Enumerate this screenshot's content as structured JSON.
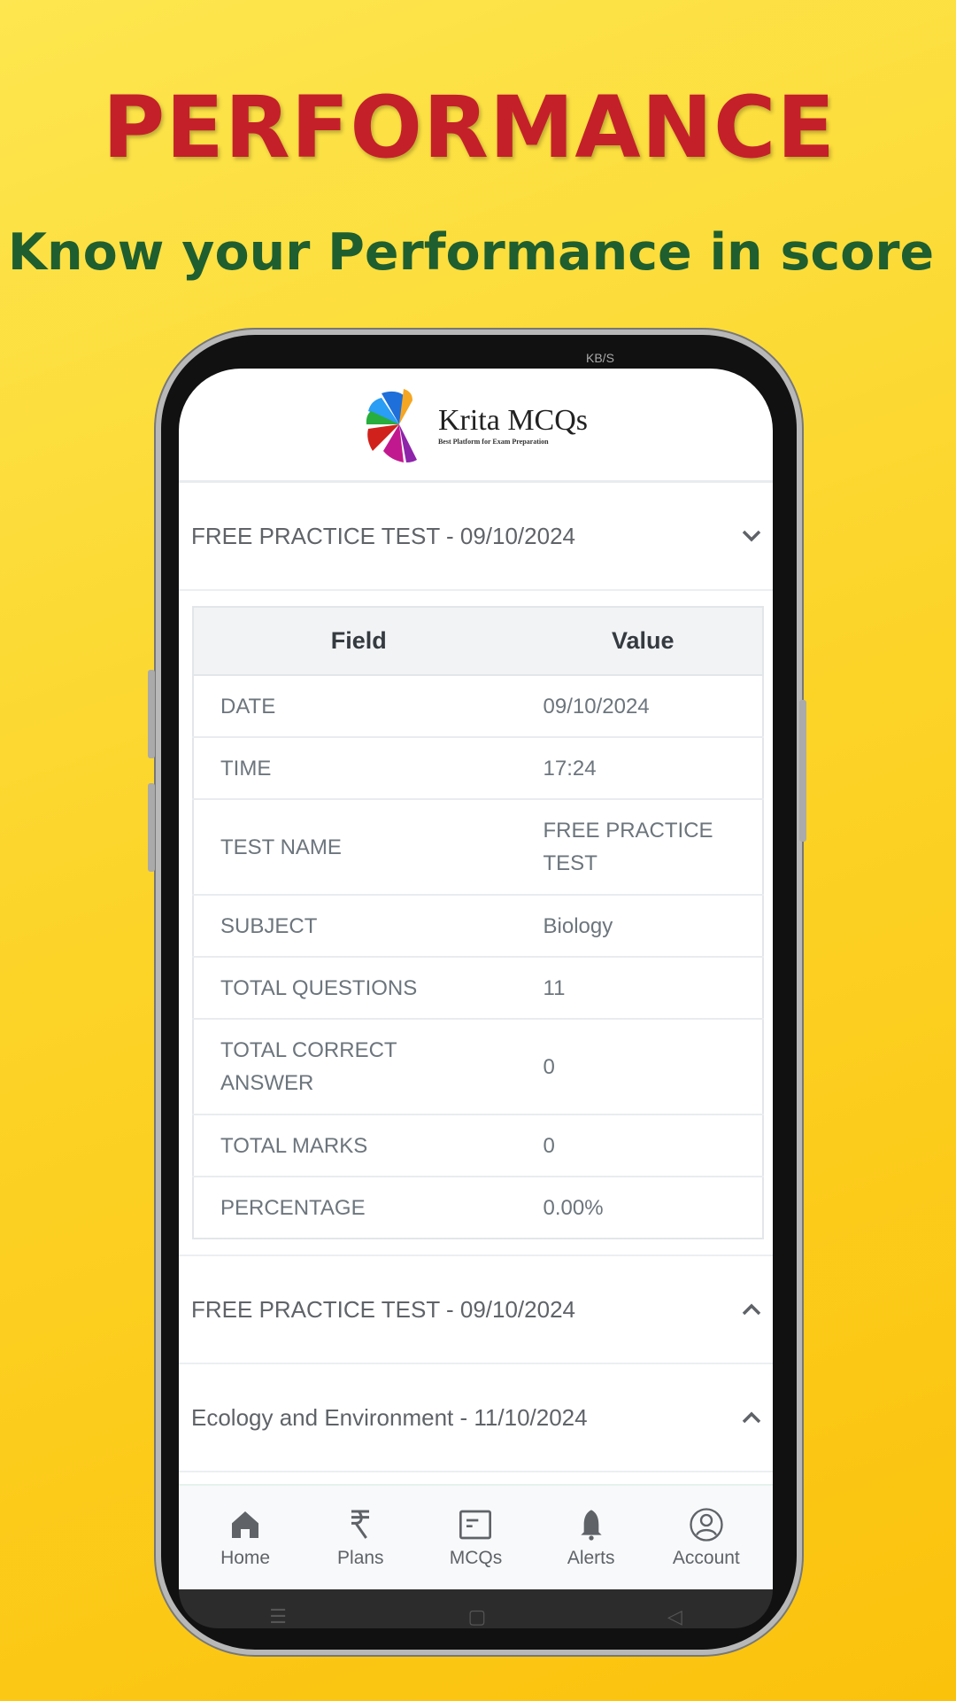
{
  "promo": {
    "title": "PERFORMANCE",
    "subtitle": "Know your Performance in score"
  },
  "statusbar": {
    "speed": "KB/S"
  },
  "app": {
    "logo_name": "Krita MCQs",
    "logo_tagline": "Best Platform for Exam Preparation"
  },
  "sections": [
    {
      "title": "FREE PRACTICE TEST - 09/10/2024",
      "expanded": true
    },
    {
      "title": "FREE PRACTICE TEST - 09/10/2024",
      "expanded": false
    },
    {
      "title": "Ecology and Environment - 11/10/2024",
      "expanded": false
    }
  ],
  "table": {
    "headers": [
      "Field",
      "Value"
    ],
    "rows": [
      [
        "DATE",
        "09/10/2024"
      ],
      [
        "TIME",
        "17:24"
      ],
      [
        "TEST NAME",
        "FREE PRACTICE TEST"
      ],
      [
        "SUBJECT",
        "Biology"
      ],
      [
        "TOTAL QUESTIONS",
        "11"
      ],
      [
        "TOTAL CORRECT ANSWER",
        "0"
      ],
      [
        "TOTAL MARKS",
        "0"
      ],
      [
        "PERCENTAGE",
        "0.00%"
      ]
    ]
  },
  "nav": [
    {
      "label": "Home",
      "icon": "home-icon"
    },
    {
      "label": "Plans",
      "icon": "rupee-icon"
    },
    {
      "label": "MCQs",
      "icon": "mcq-card-icon"
    },
    {
      "label": "Alerts",
      "icon": "bell-icon"
    },
    {
      "label": "Account",
      "icon": "account-icon"
    }
  ],
  "colors": {
    "title": "#c4202a",
    "subtitle": "#1f5e2f",
    "background": "#fcd52a"
  }
}
